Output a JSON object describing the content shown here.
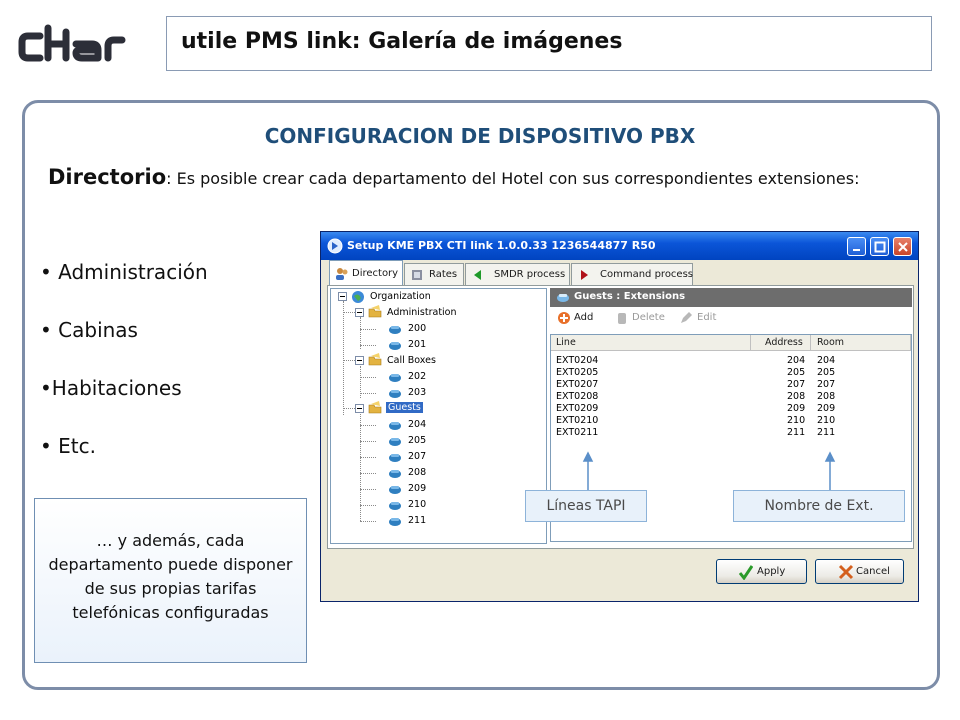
{
  "header": {
    "title": "utile PMS link: Galería de imágenes",
    "logo_text": "cHar"
  },
  "slide": {
    "heading": "CONFIGURACION DE DISPOSITIVO PBX",
    "directory_word": "Directorio",
    "directory_text": ": Es posible crear cada departamento del Hotel con sus correspondientes extensiones:",
    "bullets": [
      "• Administración",
      "• Cabinas",
      "•Habitaciones",
      "• Etc."
    ],
    "note": "… y además, cada departamento puede disponer de sus propias tarifas telefónicas configuradas"
  },
  "window": {
    "title": "Setup KME PBX CTI link 1.0.0.33  1236544877 R50",
    "tabs": [
      "Directory",
      "Rates",
      "SMDR process",
      "Command process"
    ],
    "tree": {
      "root": "Organization",
      "groups": [
        {
          "label": "Administration",
          "items": [
            "200",
            "201"
          ]
        },
        {
          "label": "Call Boxes",
          "items": [
            "202",
            "203"
          ]
        },
        {
          "label": "Guests",
          "items": [
            "204",
            "205",
            "207",
            "208",
            "209",
            "210",
            "211"
          ]
        }
      ]
    },
    "panel_title": "Guests : Extensions",
    "toolbar": {
      "add": "Add",
      "delete": "Delete",
      "edit": "Edit"
    },
    "columns": [
      "Line",
      "Address",
      "Room"
    ],
    "rows": [
      [
        "EXT0204",
        "204",
        "204"
      ],
      [
        "EXT0205",
        "205",
        "205"
      ],
      [
        "EXT0207",
        "207",
        "207"
      ],
      [
        "EXT0208",
        "208",
        "208"
      ],
      [
        "EXT0209",
        "209",
        "209"
      ],
      [
        "EXT0210",
        "210",
        "210"
      ],
      [
        "EXT0211",
        "211",
        "211"
      ]
    ],
    "apply": "Apply",
    "cancel": "Cancel"
  },
  "callouts": {
    "lines": "Líneas TAPI",
    "ext_name": "Nombre de Ext."
  },
  "colors": {
    "accent": "#1f4e79",
    "panel_border": "#7d8da8",
    "titlebar": "#0b55d8",
    "selection": "#316ac5"
  }
}
